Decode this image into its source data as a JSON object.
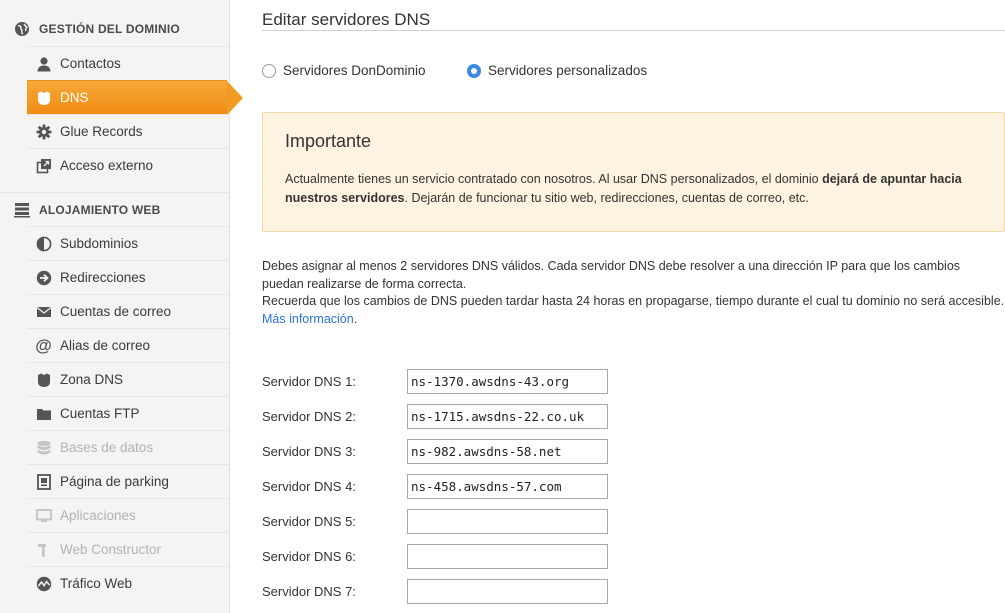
{
  "sidebar": {
    "domain_section": {
      "title": "GESTIÓN DEL DOMINIO",
      "icon": "globe-icon"
    },
    "domain_items": [
      {
        "label": "Contactos",
        "icon": "user-icon",
        "state": "normal"
      },
      {
        "label": "DNS",
        "icon": "shield-icon",
        "state": "active"
      },
      {
        "label": "Glue Records",
        "icon": "gear-icon",
        "state": "normal"
      },
      {
        "label": "Acceso externo",
        "icon": "external-link-icon",
        "state": "normal"
      }
    ],
    "hosting_section": {
      "title": "ALOJAMIENTO WEB",
      "icon": "server-icon"
    },
    "hosting_items": [
      {
        "label": "Subdominios",
        "icon": "half-circle-icon",
        "state": "normal"
      },
      {
        "label": "Redirecciones",
        "icon": "arrow-circle-icon",
        "state": "normal"
      },
      {
        "label": "Cuentas de correo",
        "icon": "envelope-icon",
        "state": "normal"
      },
      {
        "label": "Alias de correo",
        "icon": "at-icon",
        "state": "normal"
      },
      {
        "label": "Zona DNS",
        "icon": "shield-icon",
        "state": "normal"
      },
      {
        "label": "Cuentas FTP",
        "icon": "folder-icon",
        "state": "normal"
      },
      {
        "label": "Bases de datos",
        "icon": "database-icon",
        "state": "disabled"
      },
      {
        "label": "Página de parking",
        "icon": "document-icon",
        "state": "normal"
      },
      {
        "label": "Aplicaciones",
        "icon": "monitor-icon",
        "state": "disabled"
      },
      {
        "label": "Web Constructor",
        "icon": "hammer-icon",
        "state": "disabled"
      },
      {
        "label": "Tráfico Web",
        "icon": "pulse-icon",
        "state": "normal"
      }
    ]
  },
  "main": {
    "title": "Editar servidores DNS",
    "radio_options": [
      {
        "label": "Servidores DonDominio",
        "checked": false
      },
      {
        "label": "Servidores personalizados",
        "checked": true
      }
    ],
    "notice": {
      "title": "Importante",
      "text_before": "Actualmente tienes un servicio contratado con nosotros. Al usar DNS personalizados, el dominio ",
      "text_bold": "dejará de apuntar hacia nuestros servidores",
      "text_after": ". Dejarán de funcionar tu sitio web, redirecciones, cuentas de correo, etc."
    },
    "info": {
      "line1": "Debes asignar al menos 2 servidores DNS válidos. Cada servidor DNS debe resolver a una dirección IP para que los cambios puedan realizarse de forma correcta.",
      "line2": "Recuerda que los cambios de DNS pueden tardar hasta 24 horas en propagarse, tiempo durante el cual tu dominio no será accesible. ",
      "link": "Más información",
      "link_suffix": "."
    },
    "dns_servers": [
      {
        "label": "Servidor DNS 1:",
        "value": "ns-1370.awsdns-43.org"
      },
      {
        "label": "Servidor DNS 2:",
        "value": "ns-1715.awsdns-22.co.uk"
      },
      {
        "label": "Servidor DNS 3:",
        "value": "ns-982.awsdns-58.net"
      },
      {
        "label": "Servidor DNS 4:",
        "value": "ns-458.awsdns-57.com"
      },
      {
        "label": "Servidor DNS 5:",
        "value": ""
      },
      {
        "label": "Servidor DNS 6:",
        "value": ""
      },
      {
        "label": "Servidor DNS 7:",
        "value": ""
      }
    ]
  },
  "colors": {
    "accent": "#f29a24",
    "link": "#2a73d9",
    "notice_bg": "#fdf3e1",
    "radio_checked": "#3b88e8"
  }
}
